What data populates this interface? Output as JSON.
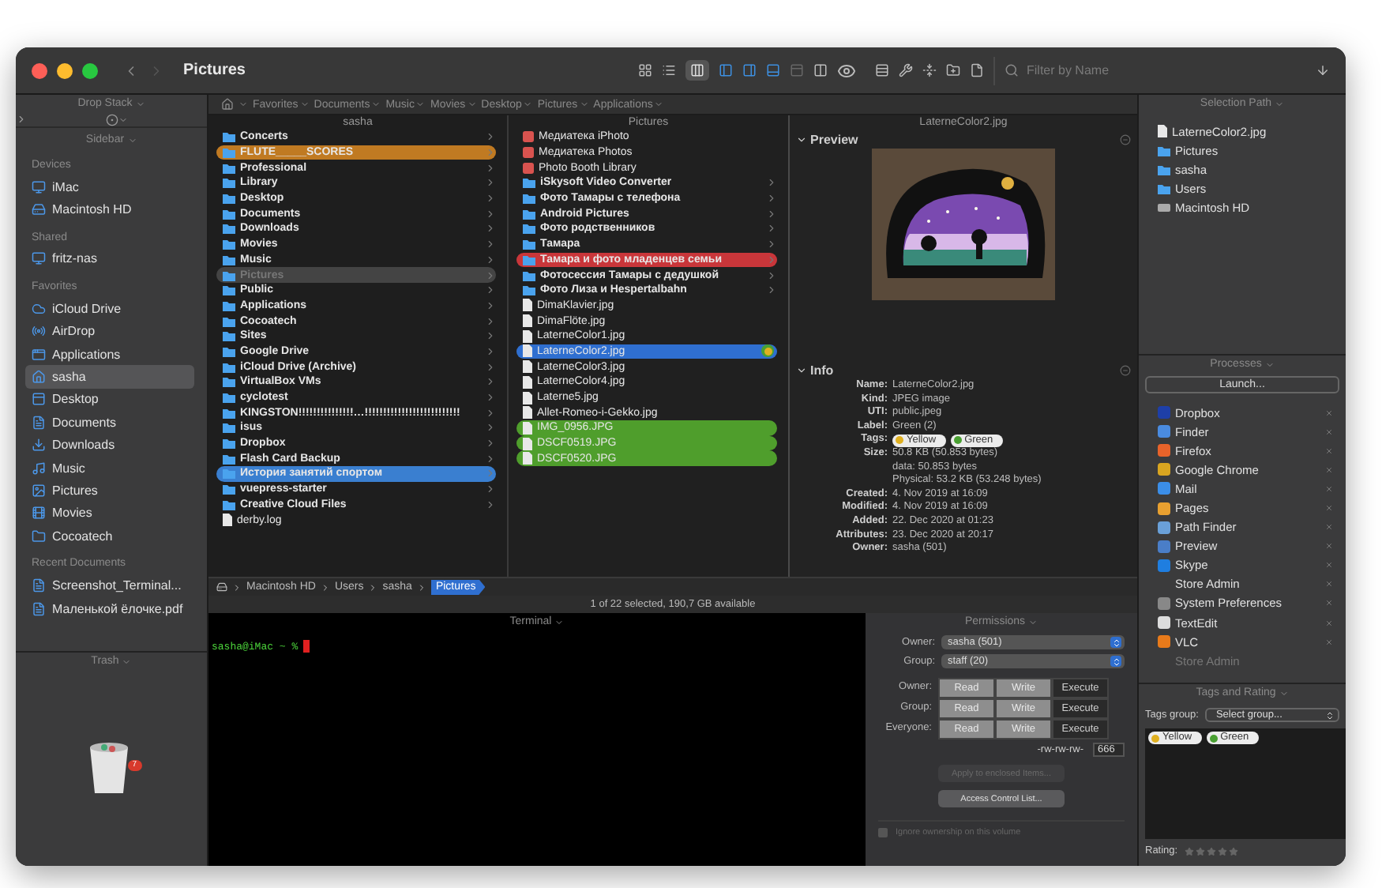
{
  "window": {
    "title": "Pictures",
    "filter": {
      "placeholder": "Filter by Name"
    }
  },
  "sidebar": {
    "drop_stack": "Drop Stack",
    "header": "Sidebar",
    "sections": [
      {
        "title": "Devices",
        "items": [
          {
            "label": "iMac",
            "selected": false
          },
          {
            "label": "Macintosh HD",
            "selected": false
          }
        ]
      },
      {
        "title": "Shared",
        "items": [
          {
            "label": "fritz-nas",
            "selected": false
          }
        ]
      },
      {
        "title": "Favorites",
        "items": [
          {
            "label": "iCloud Drive",
            "selected": false
          },
          {
            "label": "AirDrop",
            "selected": false
          },
          {
            "label": "Applications",
            "selected": false
          },
          {
            "label": "sasha",
            "selected": true
          },
          {
            "label": "Desktop",
            "selected": false
          },
          {
            "label": "Documents",
            "selected": false
          },
          {
            "label": "Downloads",
            "selected": false
          },
          {
            "label": "Music",
            "selected": false
          },
          {
            "label": "Pictures",
            "selected": false
          },
          {
            "label": "Movies",
            "selected": false
          },
          {
            "label": "Cocoatech",
            "selected": false
          }
        ]
      },
      {
        "title": "Recent Documents",
        "items": [
          {
            "label": "Screenshot_Terminal...",
            "selected": false
          },
          {
            "label": "Маленькой ёлочке.pdf",
            "selected": false
          }
        ]
      }
    ],
    "trash": {
      "title": "Trash",
      "badge": "7"
    }
  },
  "breadcrumbs": [
    "Favorites",
    "Documents",
    "Music",
    "Movies",
    "Desktop",
    "Pictures",
    "Applications"
  ],
  "columns": [
    {
      "title": "sasha",
      "active": false,
      "items": [
        {
          "name": "Concerts",
          "kind": "folder",
          "expandable": true,
          "selected": false
        },
        {
          "name": "FLUTE_____SCORES",
          "kind": "folder",
          "expandable": true,
          "selected": false,
          "color": "#c07a22"
        },
        {
          "name": "Professional",
          "kind": "folder",
          "expandable": true,
          "selected": false
        },
        {
          "name": "Library",
          "kind": "folder",
          "expandable": true,
          "selected": false
        },
        {
          "name": "Desktop",
          "kind": "folder",
          "expandable": true,
          "selected": false
        },
        {
          "name": "Documents",
          "kind": "folder",
          "expandable": true,
          "selected": false
        },
        {
          "name": "Downloads",
          "kind": "folder",
          "expandable": true,
          "selected": false
        },
        {
          "name": "Movies",
          "kind": "folder",
          "expandable": true,
          "selected": false
        },
        {
          "name": "Music",
          "kind": "folder",
          "expandable": true,
          "selected": false
        },
        {
          "name": "Pictures",
          "kind": "folder",
          "expandable": true,
          "selected": true
        },
        {
          "name": "Public",
          "kind": "folder",
          "expandable": true,
          "selected": false
        },
        {
          "name": "Applications",
          "kind": "folder",
          "expandable": true,
          "selected": false
        },
        {
          "name": "Cocoatech",
          "kind": "folder",
          "expandable": true,
          "selected": false
        },
        {
          "name": "Sites",
          "kind": "folder",
          "expandable": true,
          "selected": false
        },
        {
          "name": "Google Drive",
          "kind": "folder",
          "expandable": true,
          "selected": false
        },
        {
          "name": "iCloud Drive (Archive)",
          "kind": "folder",
          "expandable": true,
          "selected": false
        },
        {
          "name": "VirtualBox VMs",
          "kind": "folder",
          "expandable": true,
          "selected": false
        },
        {
          "name": "cyclotest",
          "kind": "folder",
          "expandable": true,
          "selected": false
        },
        {
          "name": "KINGSTON!!!!!!!!!!!!!!!…!!!!!!!!!!!!!!!!!!!!!!!!!!",
          "kind": "folder",
          "expandable": true,
          "selected": false
        },
        {
          "name": "isus",
          "kind": "folder",
          "expandable": true,
          "selected": false
        },
        {
          "name": "Dropbox",
          "kind": "folder",
          "expandable": true,
          "selected": false
        },
        {
          "name": "Flash Card Backup",
          "kind": "folder",
          "expandable": true,
          "selected": false
        },
        {
          "name": "История занятий спортом",
          "kind": "folder",
          "expandable": true,
          "selected": false,
          "color": "#3a7fd0"
        },
        {
          "name": "vuepress-starter",
          "kind": "folder",
          "expandable": true,
          "selected": false
        },
        {
          "name": "Creative Cloud Files",
          "kind": "folder",
          "expandable": true,
          "selected": false
        },
        {
          "name": "derby.log",
          "kind": "file",
          "expandable": false,
          "selected": false
        }
      ]
    },
    {
      "title": "Pictures",
      "active": true,
      "items": [
        {
          "name": "Медиатека iPhoto",
          "kind": "app",
          "expandable": false,
          "selected": false
        },
        {
          "name": "Медиатека Photos",
          "kind": "app",
          "expandable": false,
          "selected": false
        },
        {
          "name": "Photo Booth Library",
          "kind": "app",
          "expandable": false,
          "selected": false
        },
        {
          "name": "iSkysoft Video Converter",
          "kind": "folder",
          "expandable": true,
          "selected": false
        },
        {
          "name": "Фото Тамары с телефона",
          "kind": "folder",
          "expandable": true,
          "selected": false
        },
        {
          "name": "Android Pictures",
          "kind": "folder",
          "expandable": true,
          "selected": false
        },
        {
          "name": "Фото родственников",
          "kind": "folder",
          "expandable": true,
          "selected": false
        },
        {
          "name": "Тамара",
          "kind": "folder",
          "expandable": true,
          "selected": false
        },
        {
          "name": "Тамара и фото младенцев семьи",
          "kind": "folder",
          "expandable": true,
          "selected": false,
          "color": "#c9363a"
        },
        {
          "name": "Фотосессия Тамары с дедушкой",
          "kind": "folder",
          "expandable": true,
          "selected": false
        },
        {
          "name": "Фото Лиза и Hespertalbahn",
          "kind": "folder",
          "expandable": true,
          "selected": false
        },
        {
          "name": "DimaKlavier.jpg",
          "kind": "file",
          "expandable": false,
          "selected": false
        },
        {
          "name": "DimaFlöte.jpg",
          "kind": "file",
          "expandable": false,
          "selected": false
        },
        {
          "name": "LaterneColor1.jpg",
          "kind": "file",
          "expandable": false,
          "selected": false
        },
        {
          "name": "LaterneColor2.jpg",
          "kind": "file",
          "expandable": false,
          "selected": true,
          "tags": [
            {
              "color": "#e0b020"
            },
            {
              "color": "#4aa032"
            }
          ]
        },
        {
          "name": "LaterneColor3.jpg",
          "kind": "file",
          "expandable": false,
          "selected": false
        },
        {
          "name": "LaterneColor4.jpg",
          "kind": "file",
          "expandable": false,
          "selected": false
        },
        {
          "name": "Laterne5.jpg",
          "kind": "file",
          "expandable": false,
          "selected": false
        },
        {
          "name": "Allet-Romeo-i-Gekko.jpg",
          "kind": "file",
          "expandable": false,
          "selected": false
        },
        {
          "name": "IMG_0956.JPG",
          "kind": "file",
          "expandable": false,
          "selected": false,
          "color": "#4f9e2c"
        },
        {
          "name": "DSCF0519.JPG",
          "kind": "file",
          "expandable": false,
          "selected": false,
          "color": "#4f9e2c"
        },
        {
          "name": "DSCF0520.JPG",
          "kind": "file",
          "expandable": false,
          "selected": false,
          "color": "#4f9e2c"
        }
      ]
    }
  ],
  "preview": {
    "title": "LaterneColor2.jpg",
    "section": "Preview"
  },
  "info": {
    "section": "Info",
    "rows": [
      {
        "label": "Name:",
        "lines": [
          "LaterneColor2.jpg"
        ]
      },
      {
        "label": "Kind:",
        "lines": [
          "JPEG image"
        ]
      },
      {
        "label": "UTI:",
        "lines": [
          "public.jpeg"
        ]
      },
      {
        "label": "Label:",
        "lines": [
          "Green (2)"
        ]
      },
      {
        "label": "Tags:",
        "tags": [
          {
            "label": "Yellow",
            "color": "#e0b020"
          },
          {
            "label": "Green",
            "color": "#4aa032"
          }
        ]
      },
      {
        "label": "Size:",
        "lines": [
          "50.8 KB (50.853 bytes)",
          "data: 50.853 bytes",
          "Physical: 53.2 KB (53.248 bytes)"
        ]
      },
      {
        "label": "Created:",
        "lines": [
          "4. Nov 2019 at 16:09"
        ]
      },
      {
        "label": "Modified:",
        "lines": [
          "4. Nov 2019 at 16:09"
        ]
      },
      {
        "label": "Added:",
        "lines": [
          "22. Dec 2020 at 01:23"
        ]
      },
      {
        "label": "Attributes:",
        "lines": [
          "23. Dec 2020 at 20:17"
        ]
      },
      {
        "label": "Owner:",
        "lines": [
          "sasha (501)"
        ]
      }
    ]
  },
  "path_bar": [
    {
      "label": "Macintosh HD",
      "selected": false
    },
    {
      "label": "Users",
      "selected": false
    },
    {
      "label": "sasha",
      "selected": false
    },
    {
      "label": "Pictures",
      "selected": true
    }
  ],
  "status_bar": "1 of 22 selected, 190,7 GB available",
  "terminal": {
    "title": "Terminal",
    "prompt": "sasha@iMac ~ %"
  },
  "permissions": {
    "title": "Permissions",
    "owner_label": "Owner:",
    "owner": "sasha (501)",
    "group_label": "Group:",
    "group": "staff (20)",
    "matrix": [
      {
        "label": "Owner:",
        "cells": [
          {
            "label": "Read",
            "on": true
          },
          {
            "label": "Write",
            "on": true
          },
          {
            "label": "Execute",
            "on": false
          }
        ]
      },
      {
        "label": "Group:",
        "cells": [
          {
            "label": "Read",
            "on": true
          },
          {
            "label": "Write",
            "on": true
          },
          {
            "label": "Execute",
            "on": false
          }
        ]
      },
      {
        "label": "Everyone:",
        "cells": [
          {
            "label": "Read",
            "on": true
          },
          {
            "label": "Write",
            "on": true
          },
          {
            "label": "Execute",
            "on": false
          }
        ]
      }
    ],
    "mode": "-rw-rw-rw-",
    "octal": "666",
    "buttons": [
      {
        "label": "Apply to enclosed Items...",
        "disabled": true
      },
      {
        "label": "Access Control List...",
        "disabled": false
      }
    ],
    "ignore_ownership": {
      "label": "Ignore ownership on this volume",
      "checked": false
    }
  },
  "selection_path": {
    "title": "Selection Path",
    "items": [
      {
        "label": "LaterneColor2.jpg",
        "kind": "file"
      },
      {
        "label": "Pictures",
        "kind": "folder"
      },
      {
        "label": "sasha",
        "kind": "folder"
      },
      {
        "label": "Users",
        "kind": "folder"
      },
      {
        "label": "Macintosh HD",
        "kind": "disk"
      }
    ]
  },
  "processes": {
    "title": "Processes",
    "launch": "Launch...",
    "items": [
      {
        "name": "Dropbox",
        "dimmed": false
      },
      {
        "name": "Finder",
        "dimmed": false
      },
      {
        "name": "Firefox",
        "dimmed": false
      },
      {
        "name": "Google Chrome",
        "dimmed": false
      },
      {
        "name": "Mail",
        "dimmed": false
      },
      {
        "name": "Pages",
        "dimmed": false
      },
      {
        "name": "Path Finder",
        "dimmed": false
      },
      {
        "name": "Preview",
        "dimmed": false
      },
      {
        "name": "Skype",
        "dimmed": false
      },
      {
        "name": "Store Admin",
        "dimmed": false
      },
      {
        "name": "System Preferences",
        "dimmed": false
      },
      {
        "name": "TextEdit",
        "dimmed": false
      },
      {
        "name": "VLC",
        "dimmed": false
      },
      {
        "name": "Store Admin",
        "dimmed": true
      }
    ]
  },
  "tags_rating": {
    "title": "Tags and Rating",
    "group_label": "Tags group:",
    "group": "Select group...",
    "tags": [
      {
        "label": "Yellow",
        "color": "#e0b020"
      },
      {
        "label": "Green",
        "color": "#4aa032"
      }
    ],
    "rating_label": "Rating:",
    "stars": 0
  }
}
